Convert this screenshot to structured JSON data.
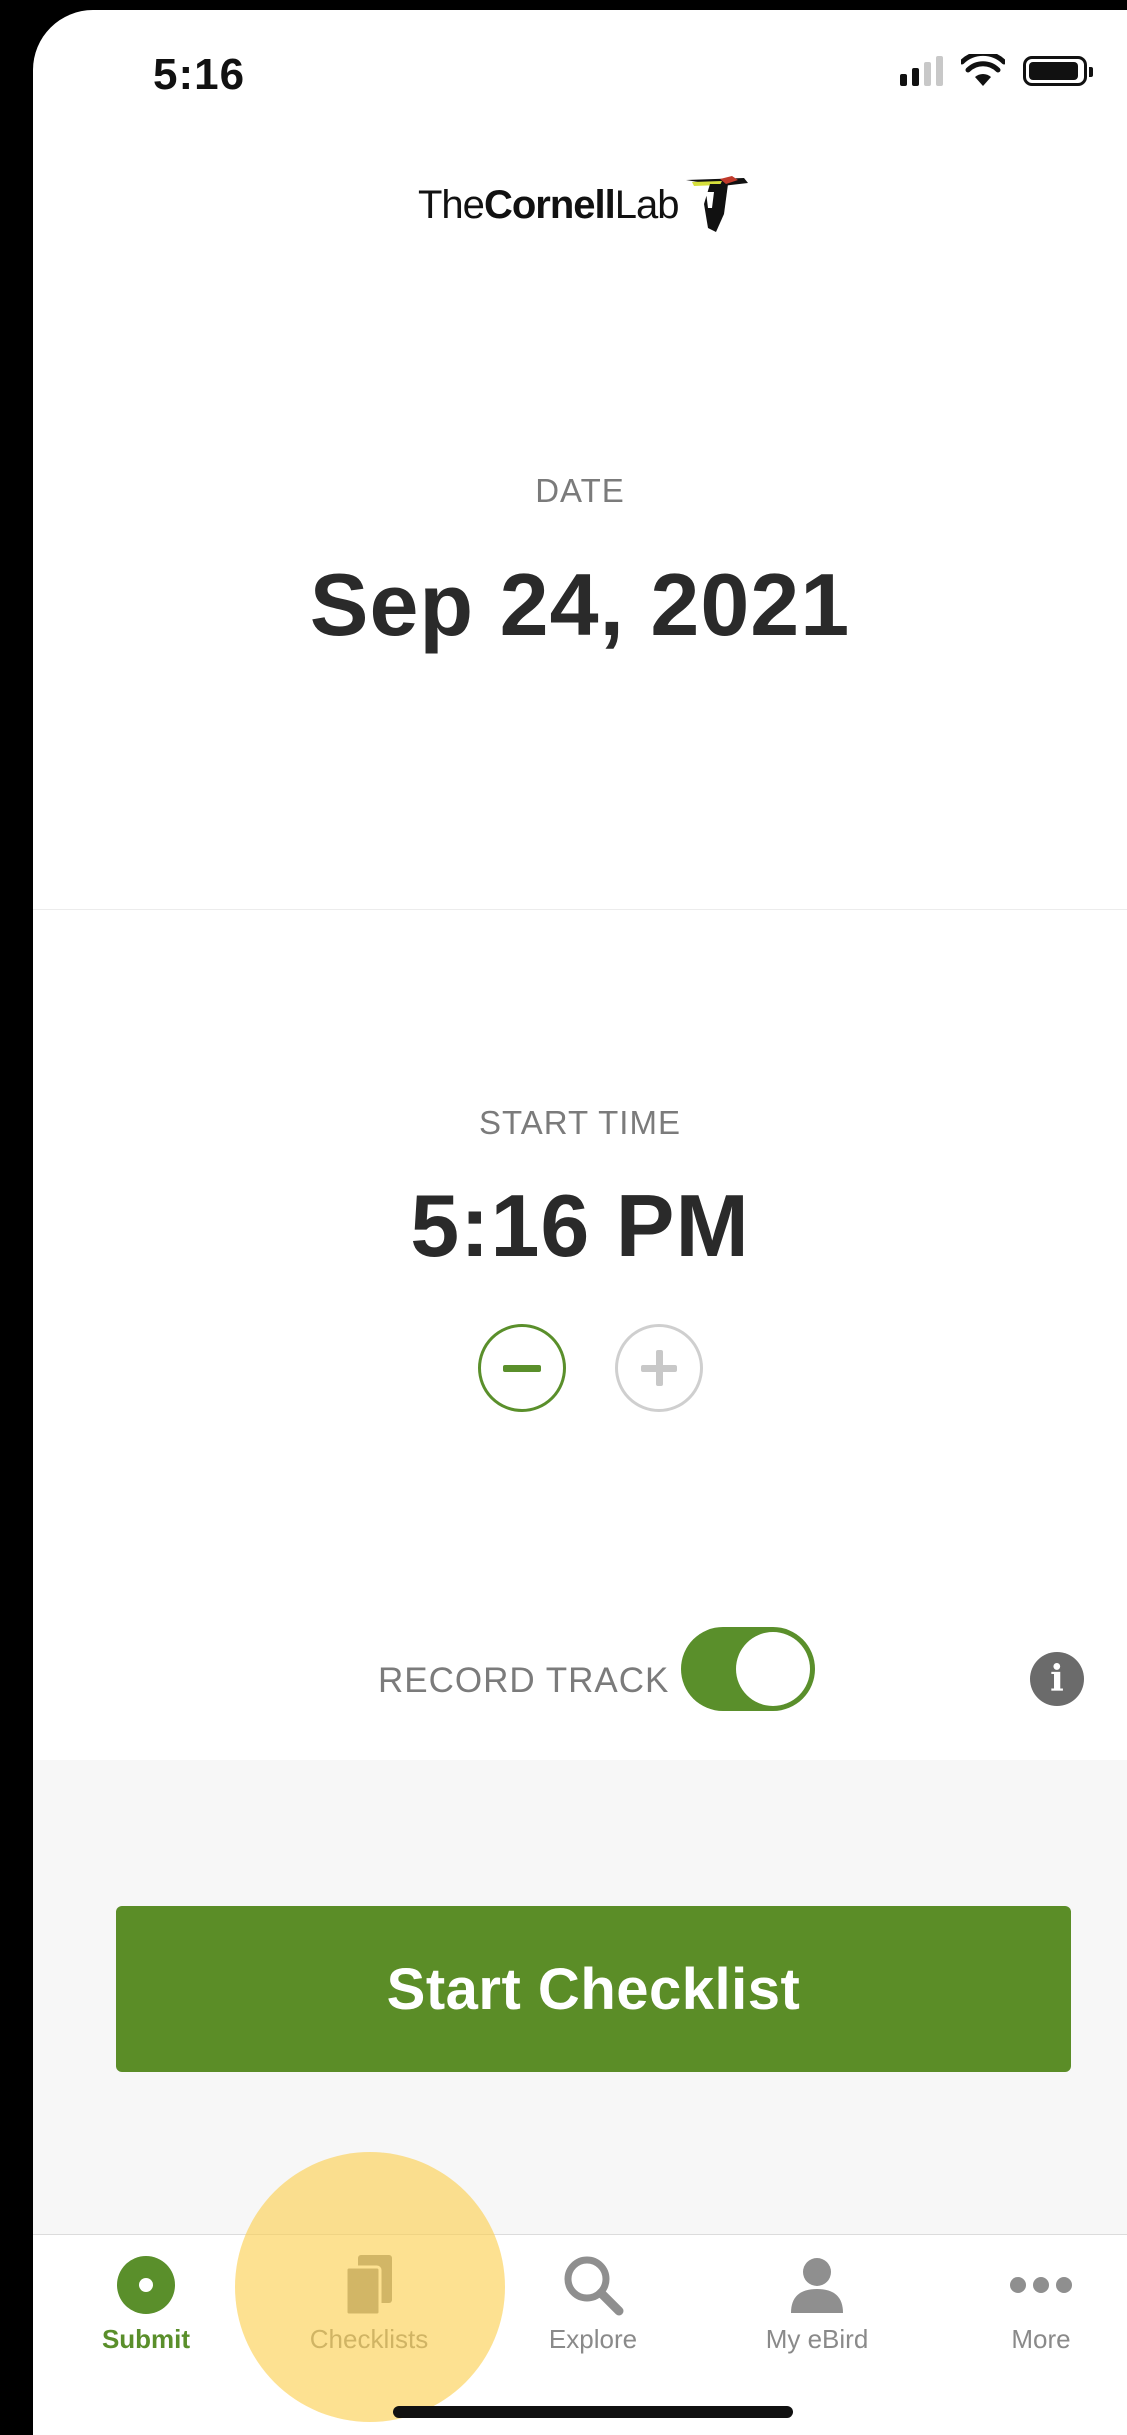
{
  "status_bar": {
    "time": "5:16"
  },
  "header": {
    "logo_the": "The",
    "logo_cornell": "Cornell",
    "logo_lab": "Lab"
  },
  "date": {
    "label": "DATE",
    "value": "Sep 24, 2021"
  },
  "start_time": {
    "label": "START TIME",
    "value": "5:16 PM"
  },
  "record_track": {
    "label": "RECORD TRACK",
    "enabled": true
  },
  "start_button": {
    "label": "Start Checklist"
  },
  "tabs": [
    {
      "label": "Submit",
      "icon": "submit-icon",
      "active": true
    },
    {
      "label": "Checklists",
      "icon": "checklists-icon",
      "active": false
    },
    {
      "label": "Explore",
      "icon": "search-icon",
      "active": false
    },
    {
      "label": "My eBird",
      "icon": "person-icon",
      "active": false
    },
    {
      "label": "More",
      "icon": "more-icon",
      "active": false
    }
  ],
  "colors": {
    "accent": "#5b8d27",
    "highlight": "#fccf4e",
    "label_gray": "#7b7b7b"
  }
}
